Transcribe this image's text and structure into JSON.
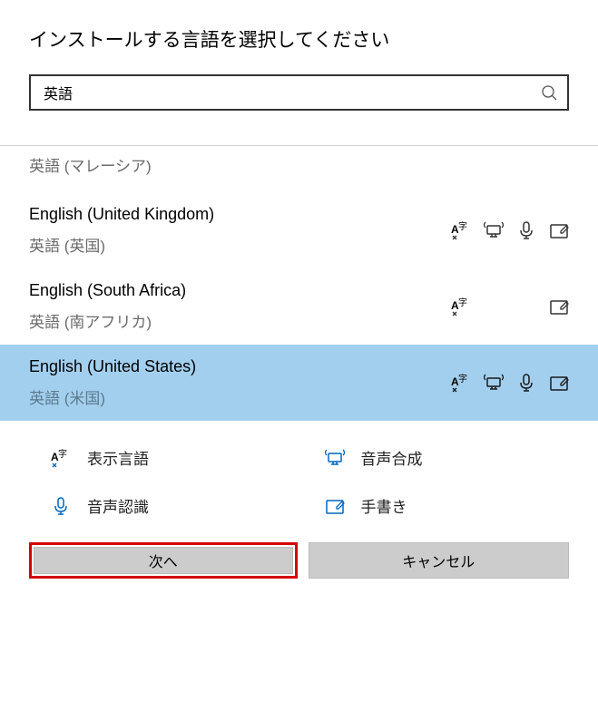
{
  "title": "インストールする言語を選択してください",
  "search": {
    "value": "英語"
  },
  "languages": [
    {
      "primary": "",
      "secondary": "英語 (マレーシア)",
      "features": [],
      "partial": true,
      "selected": false
    },
    {
      "primary": "English (United Kingdom)",
      "secondary": "英語 (英国)",
      "features": [
        "display",
        "tts",
        "speech",
        "handwriting"
      ],
      "selected": false
    },
    {
      "primary": "English (South Africa)",
      "secondary": "英語 (南アフリカ)",
      "features": [
        "display",
        "handwriting"
      ],
      "selected": false,
      "spaced": true
    },
    {
      "primary": "English (United States)",
      "secondary": "英語 (米国)",
      "features": [
        "display",
        "tts",
        "speech",
        "handwriting"
      ],
      "selected": true
    }
  ],
  "legend": {
    "display": "表示言語",
    "tts": "音声合成",
    "speech": "音声認識",
    "handwriting": "手書き"
  },
  "buttons": {
    "next": "次へ",
    "cancel": "キャンセル"
  }
}
